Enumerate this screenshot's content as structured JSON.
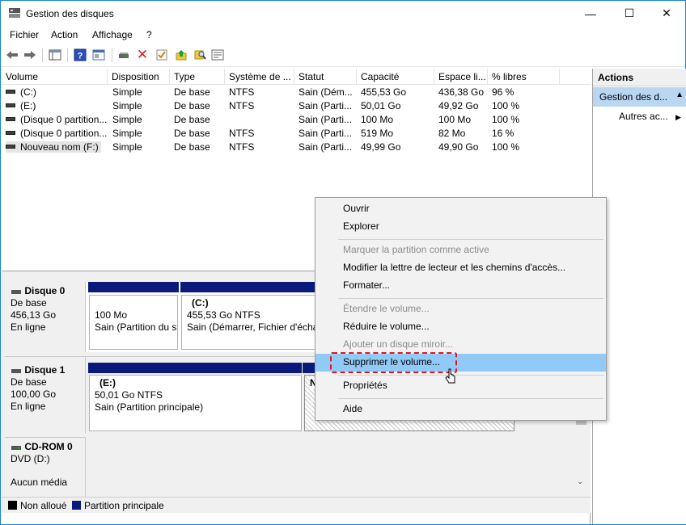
{
  "window": {
    "title": "Gestion des disques"
  },
  "titlebar": {
    "min": "—",
    "max": "☐",
    "close": "✕"
  },
  "menu": [
    "Fichier",
    "Action",
    "Affichage",
    "?"
  ],
  "columns": [
    "Volume",
    "Disposition",
    "Type",
    "Système de ...",
    "Statut",
    "Capacité",
    "Espace li...",
    "% libres"
  ],
  "volumes": [
    {
      "name": "(C:)",
      "layout": "Simple",
      "type": "De base",
      "fs": "NTFS",
      "status": "Sain (Dém...",
      "capacity": "455,53 Go",
      "free": "436,38 Go",
      "pct": "96 %"
    },
    {
      "name": "(E:)",
      "layout": "Simple",
      "type": "De base",
      "fs": "NTFS",
      "status": "Sain (Parti...",
      "capacity": "50,01 Go",
      "free": "49,92 Go",
      "pct": "100 %"
    },
    {
      "name": "(Disque 0 partition...",
      "layout": "Simple",
      "type": "De base",
      "fs": "",
      "status": "Sain (Parti...",
      "capacity": "100 Mo",
      "free": "100 Mo",
      "pct": "100 %"
    },
    {
      "name": "(Disque 0 partition...",
      "layout": "Simple",
      "type": "De base",
      "fs": "NTFS",
      "status": "Sain (Parti...",
      "capacity": "519 Mo",
      "free": "82 Mo",
      "pct": "16 %"
    },
    {
      "name": "Nouveau nom (F:)",
      "layout": "Simple",
      "type": "De base",
      "fs": "NTFS",
      "status": "Sain (Parti...",
      "capacity": "49,99 Go",
      "free": "49,90 Go",
      "pct": "100 %"
    }
  ],
  "disks": {
    "disk0": {
      "name": "Disque 0",
      "type": "De base",
      "size": "456,13 Go",
      "state": "En ligne",
      "p1": {
        "size": "100 Mo",
        "status": "Sain (Partition du s"
      },
      "p2": {
        "label": "(C:)",
        "size": "455,53 Go NTFS",
        "status": "Sain (Démarrer, Fichier d'écha"
      }
    },
    "disk1": {
      "name": "Disque 1",
      "type": "De base",
      "size": "100,00 Go",
      "state": "En ligne",
      "p1": {
        "label": "(E:)",
        "size": "50,01 Go NTFS",
        "status": "Sain (Partition principale)"
      },
      "p2": {
        "label": "N",
        "size": "49"
      }
    },
    "cdrom": {
      "name": "CD-ROM 0",
      "drive": "DVD (D:)",
      "media": "Aucun média"
    }
  },
  "legend": {
    "unallocated": "Non alloué",
    "unallocated_color": "#000000",
    "primary": "Partition principale",
    "primary_color": "#0b1a7a"
  },
  "actions": {
    "header": "Actions",
    "selected": "Gestion des d...",
    "more": "Autres ac..."
  },
  "context_menu": {
    "open": "Ouvrir",
    "explore": "Explorer",
    "mark_active": "Marquer la partition comme active",
    "change_letter": "Modifier la lettre de lecteur et les chemins d'accès...",
    "format": "Formater...",
    "extend": "Étendre le volume...",
    "shrink": "Réduire le volume...",
    "add_mirror": "Ajouter un disque miroir...",
    "delete": "Supprimer le volume...",
    "properties": "Propriétés",
    "help": "Aide"
  },
  "colors": {
    "highlight": "#91c9f7",
    "annotation": "#e0161e",
    "partition_bar": "#0b1a7a"
  }
}
